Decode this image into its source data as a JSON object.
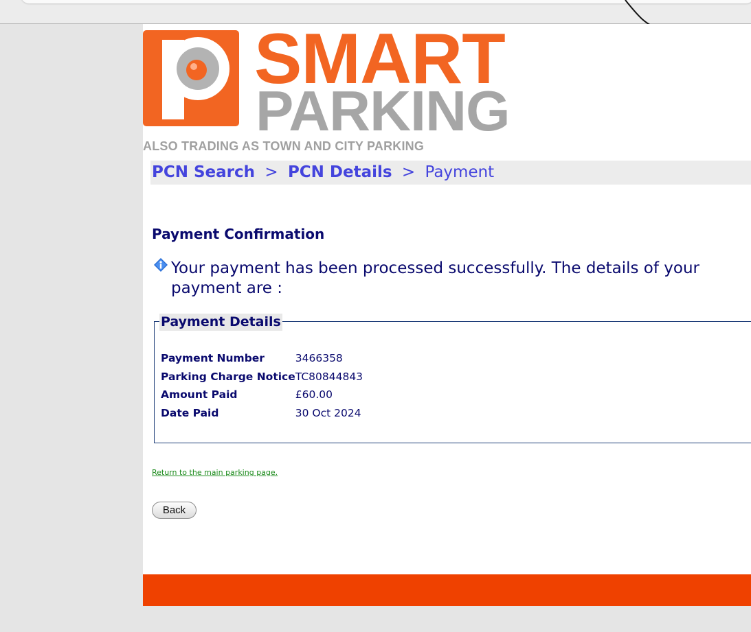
{
  "logo": {
    "word1": "SMART",
    "word2": "PARKING",
    "tagline": "ALSO TRADING AS TOWN AND CITY PARKING",
    "colors": {
      "orange": "#f26522",
      "grey": "#a6a6a6"
    }
  },
  "breadcrumb": {
    "items": [
      {
        "label": "PCN Search"
      },
      {
        "label": "PCN Details"
      },
      {
        "label": "Payment"
      }
    ],
    "separator": ">"
  },
  "main": {
    "title": "Payment Confirmation",
    "info_message": "Your payment has been processed successfully. The details of your payment are :",
    "details": {
      "legend": "Payment Details",
      "rows": [
        {
          "label": "Payment Number",
          "value": "3466358"
        },
        {
          "label": "Parking Charge Notice",
          "value": "TC80844843"
        },
        {
          "label": "Amount Paid",
          "value": "£60.00"
        },
        {
          "label": "Date Paid",
          "value": "30 Oct 2024"
        }
      ]
    },
    "return_link": "Return to the main parking page.",
    "back_button": "Back"
  },
  "colors": {
    "text_navy": "#0a0a6e",
    "breadcrumb_blue": "#4444dd",
    "link_green": "#1a8a1a",
    "footer_orange": "#ef4100"
  }
}
